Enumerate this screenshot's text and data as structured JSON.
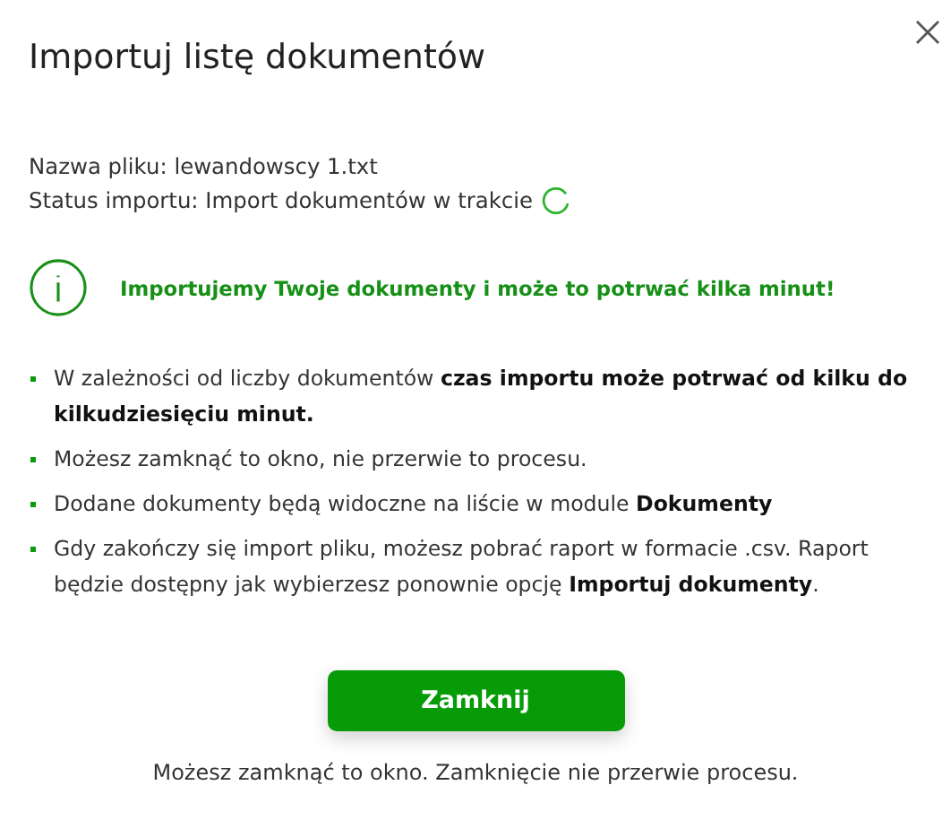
{
  "dialog": {
    "title": "Importuj listę dokumentów"
  },
  "file_name": "Nazwa pliku: lewandowscy 1.txt",
  "import_status": {
    "text": "Status importu: Import dokumentów w trakcie",
    "loading": true
  },
  "info_message": "Importujemy Twoje dokumenty i może to potrwać kilka minut!",
  "bullets": [
    "W zależności od liczby dokumentów **czas importu może potrwać od kilku do kilkudziesięciu minut.**",
    "Możesz zamknąć to okno, nie przerwie to procesu.",
    "Dodane dokumenty będą widoczne na liście w module **Dokumenty**",
    "Gdy zakończy się import pliku, możesz pobrać raport w formacie .csv. Raport będzie dostępny jak wybierzesz ponownie opcję **Importuj dokumenty**."
  ],
  "button": "Zamknij",
  "footer": "Możesz zamknąć to okno. Zamknięcie nie przerwie procesu."
}
